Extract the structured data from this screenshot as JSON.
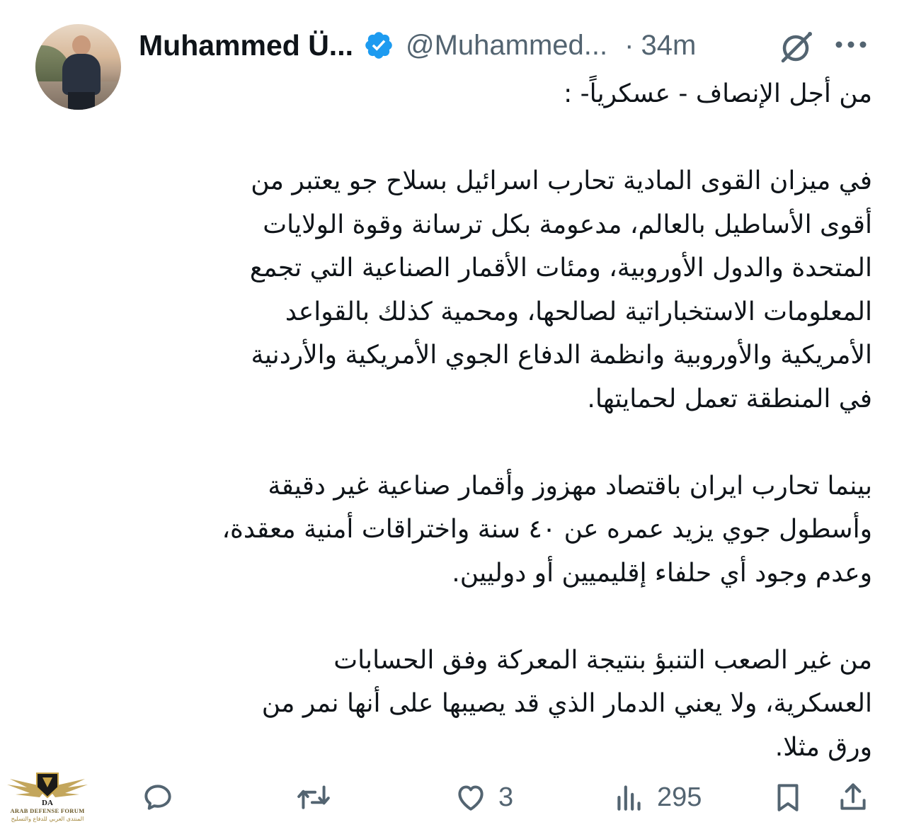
{
  "tweet": {
    "display_name": "Muhammed Ü...",
    "handle": "@Muhammed...",
    "separator": "·",
    "time": "34m",
    "verified": true,
    "paragraphs": [
      [
        "من أجل الإنصاف - عسكرياً- :"
      ],
      [
        "في ميزان القوى المادية تحارب اسرائيل بسلاح جو يعتبر من",
        "أقوى الأساطيل بالعالم، مدعومة بكل ترسانة وقوة الولايات",
        "المتحدة والدول الأوروبية، ومئات الأقمار الصناعية التي تجمع",
        "المعلومات الاستخباراتية لصالحها، ومحمية كذلك بالقواعد",
        "الأمريكية والأوروبية وانظمة الدفاع الجوي الأمريكية والأردنية",
        "في المنطقة تعمل لحمايتها."
      ],
      [
        "بينما تحارب ايران باقتصاد مهزوز وأقمار صناعية غير دقيقة",
        "وأسطول جوي يزيد عمره عن ٤٠ سنة واختراقات أمنية معقدة،",
        "وعدم وجود أي حلفاء إقليميين أو دوليين."
      ],
      [
        "من غير الصعب التنبؤ بنتيجة المعركة وفق الحسابات",
        "العسكرية، ولا يعني الدمار الذي قد يصيبها على أنها نمر من",
        "ورق مثلا."
      ]
    ]
  },
  "actions": {
    "reply_count": "",
    "retweet_count": "",
    "like_count": "3",
    "views_count": "295"
  },
  "watermark": {
    "logo_text": "DA",
    "line1": "ARAB DEFENSE FORUM",
    "line2": "المنتدى العربي للدفاع والتسليح"
  },
  "colors": {
    "text": "#0f1419",
    "secondary": "#536471",
    "verified_blue": "#1d9bf0",
    "background": "#ffffff"
  },
  "icons": [
    "verified-badge-icon",
    "grok-icon",
    "more-icon",
    "reply-icon",
    "retweet-icon",
    "like-icon",
    "views-icon",
    "bookmark-icon",
    "share-icon"
  ]
}
